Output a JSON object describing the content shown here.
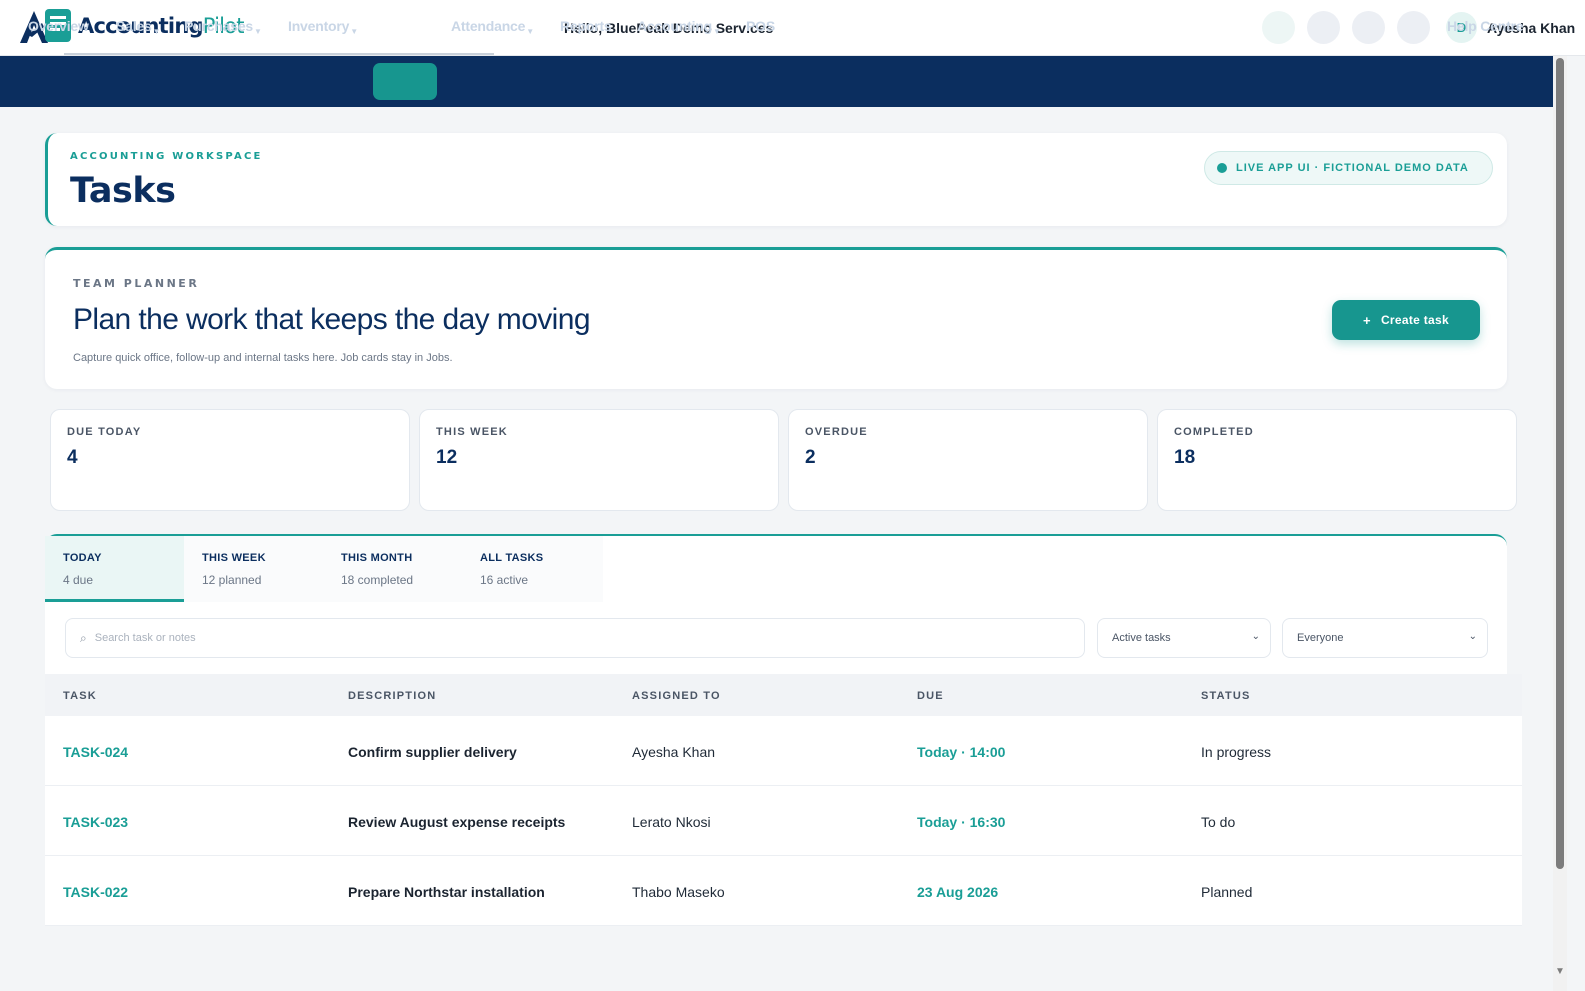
{
  "header": {
    "brand_primary": "Accounting",
    "brand_secondary": "Pilot",
    "greeting": "Hello, BluePeak Demo Services",
    "avatar_initial": "D",
    "user_name": "Ayesha Khan"
  },
  "nav": {
    "items": [
      {
        "label": "Overview",
        "dropdown": false
      },
      {
        "label": "Sales",
        "dropdown": true
      },
      {
        "label": "Purchases",
        "dropdown": true
      },
      {
        "label": "Inventory",
        "dropdown": true
      },
      {
        "label": "Work",
        "dropdown": true,
        "active": true
      },
      {
        "label": "Attendance",
        "dropdown": true
      },
      {
        "label": "Reports",
        "dropdown": false
      },
      {
        "label": "Accounting",
        "dropdown": true
      },
      {
        "label": "POS",
        "dropdown": false
      }
    ],
    "help": "Help Centre",
    "caret": "▼"
  },
  "workspace": {
    "eyebrow": "ACCOUNTING WORKSPACE",
    "title": "Tasks",
    "badge": "LIVE APP UI · FICTIONAL DEMO DATA"
  },
  "planner": {
    "eyebrow": "TEAM PLANNER",
    "title": "Plan the work that keeps the day moving",
    "subtitle": "Capture quick office, follow-up and internal tasks here. Job cards stay in Jobs.",
    "create_label": "Create task",
    "create_icon": "+"
  },
  "stats": [
    {
      "label": "DUE TODAY",
      "value": "4"
    },
    {
      "label": "THIS WEEK",
      "value": "12"
    },
    {
      "label": "OVERDUE",
      "value": "2"
    },
    {
      "label": "COMPLETED",
      "value": "18"
    }
  ],
  "tabs": [
    {
      "title": "TODAY",
      "sub": "4 due",
      "active": true
    },
    {
      "title": "THIS WEEK",
      "sub": "12 planned"
    },
    {
      "title": "THIS MONTH",
      "sub": "18 completed"
    },
    {
      "title": "ALL TASKS",
      "sub": "16 active"
    }
  ],
  "filters": {
    "search_placeholder": "Search task or notes",
    "search_icon": "⌕",
    "status_filter": "Active tasks",
    "assignee_filter": "Everyone",
    "chevron": "⌄"
  },
  "table": {
    "columns": [
      "TASK",
      "DESCRIPTION",
      "ASSIGNED TO",
      "DUE",
      "STATUS"
    ],
    "rows": [
      {
        "id": "TASK-024",
        "description": "Confirm supplier delivery",
        "assigned": "Ayesha Khan",
        "due": "Today · 14:00",
        "status": "In progress"
      },
      {
        "id": "TASK-023",
        "description": "Review August expense receipts",
        "assigned": "Lerato Nkosi",
        "due": "Today · 16:30",
        "status": "To do"
      },
      {
        "id": "TASK-022",
        "description": "Prepare Northstar installation",
        "assigned": "Thabo Maseko",
        "due": "23 Aug 2026",
        "status": "Planned"
      }
    ]
  },
  "colors": {
    "navy": "#0b2e5f",
    "teal": "#1a9e96",
    "button_teal": "#17968f"
  }
}
